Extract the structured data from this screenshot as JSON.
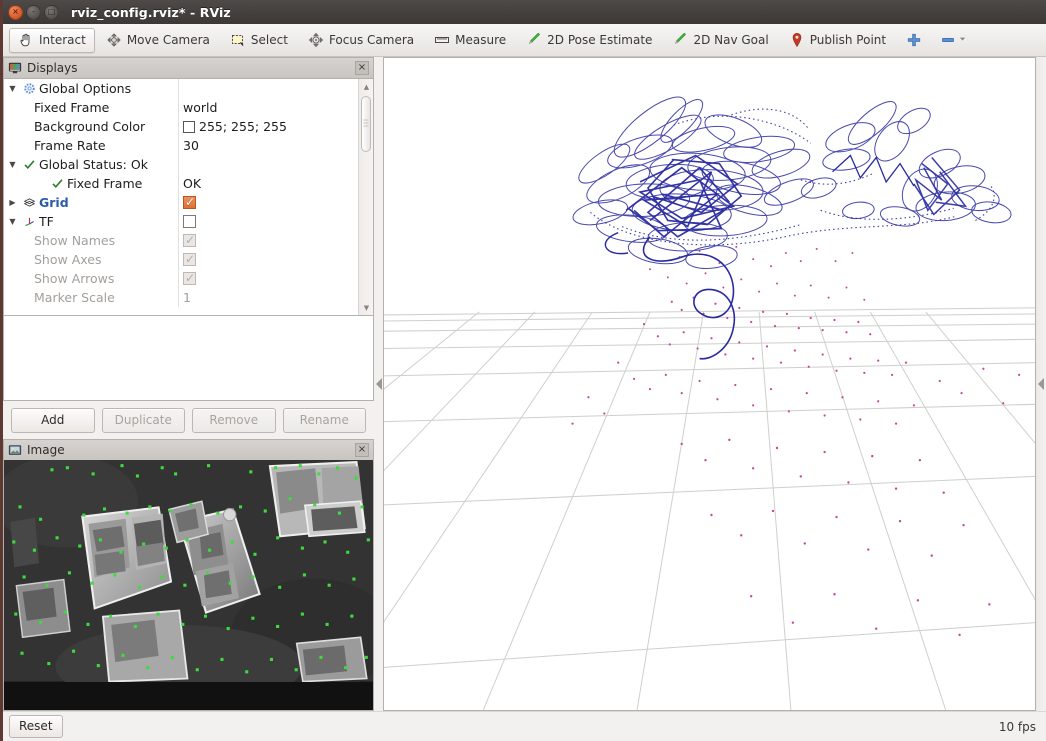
{
  "window": {
    "title": "rviz_config.rviz* - RViz",
    "buttons": [
      {
        "name": "close",
        "glyph": "×"
      },
      {
        "name": "minimize",
        "glyph": "–"
      },
      {
        "name": "maximize",
        "glyph": "□"
      }
    ]
  },
  "toolbar": {
    "items": [
      {
        "label": "Interact",
        "icon": "hand-cursor-icon",
        "active": true
      },
      {
        "label": "Move Camera",
        "icon": "move-camera-icon",
        "active": false
      },
      {
        "label": "Select",
        "icon": "select-rectangle-icon",
        "active": false
      },
      {
        "label": "Focus Camera",
        "icon": "focus-camera-icon",
        "active": false
      },
      {
        "label": "Measure",
        "icon": "ruler-icon",
        "active": false
      },
      {
        "label": "2D Pose Estimate",
        "icon": "pose-arrow-icon",
        "active": false
      },
      {
        "label": "2D Nav Goal",
        "icon": "nav-goal-arrow-icon",
        "active": false
      },
      {
        "label": "Publish Point",
        "icon": "map-pin-icon",
        "active": false
      }
    ],
    "add_tool_label": "+",
    "remove_tool_label": "–"
  },
  "displays_panel": {
    "title": "Displays",
    "icon": "monitor-icon",
    "close_label": "×",
    "rows": [
      {
        "indent": 0,
        "twisty": "▼",
        "icon": "gear-icon",
        "name": "Global Options",
        "value": "",
        "value_type": "none",
        "style": "normal"
      },
      {
        "indent": 1,
        "twisty": "",
        "icon": "",
        "name": "Fixed Frame",
        "value": "world",
        "value_type": "text",
        "style": "normal"
      },
      {
        "indent": 1,
        "twisty": "",
        "icon": "",
        "name": "Background Color",
        "value": "255; 255; 255",
        "value_type": "color",
        "color": "#ffffff",
        "style": "normal"
      },
      {
        "indent": 1,
        "twisty": "",
        "icon": "",
        "name": "Frame Rate",
        "value": "30",
        "value_type": "text",
        "style": "normal"
      },
      {
        "indent": 0,
        "twisty": "▼",
        "icon": "check-icon",
        "name": "Global Status: Ok",
        "value": "",
        "value_type": "none",
        "style": "normal"
      },
      {
        "indent": 1,
        "twisty": "",
        "icon": "check-icon",
        "name": "Fixed Frame",
        "value": "OK",
        "value_type": "text",
        "style": "normal"
      },
      {
        "indent": 0,
        "twisty": "▶",
        "icon": "grid-icon",
        "name": "Grid",
        "value": "",
        "value_type": "checkbox-checked",
        "style": "blue"
      },
      {
        "indent": 0,
        "twisty": "▼",
        "icon": "tf-axes-icon",
        "name": "TF",
        "value": "",
        "value_type": "checkbox-unchecked",
        "style": "normal"
      },
      {
        "indent": 2,
        "twisty": "",
        "icon": "",
        "name": "Show Names",
        "value": "",
        "value_type": "checkbox-disabled",
        "style": "dim"
      },
      {
        "indent": 2,
        "twisty": "",
        "icon": "",
        "name": "Show Axes",
        "value": "",
        "value_type": "checkbox-disabled",
        "style": "dim"
      },
      {
        "indent": 2,
        "twisty": "",
        "icon": "",
        "name": "Show Arrows",
        "value": "",
        "value_type": "checkbox-disabled",
        "style": "dim"
      },
      {
        "indent": 2,
        "twisty": "",
        "icon": "",
        "name": "Marker Scale",
        "value": "1",
        "value_type": "text",
        "style": "dim"
      }
    ],
    "buttons": [
      {
        "label": "Add",
        "enabled": true
      },
      {
        "label": "Duplicate",
        "enabled": false
      },
      {
        "label": "Remove",
        "enabled": false
      },
      {
        "label": "Rename",
        "enabled": false
      }
    ]
  },
  "image_panel": {
    "title": "Image",
    "icon": "image-icon",
    "close_label": "×"
  },
  "view3d": {
    "name": "3d-render-view",
    "background": "#ffffff",
    "grid_color": "#c9c9c9",
    "trajectory_color": "#2020a0",
    "pointcloud_color": "#cc4499"
  },
  "status_bar": {
    "reset_label": "Reset",
    "fps": "10 fps"
  }
}
